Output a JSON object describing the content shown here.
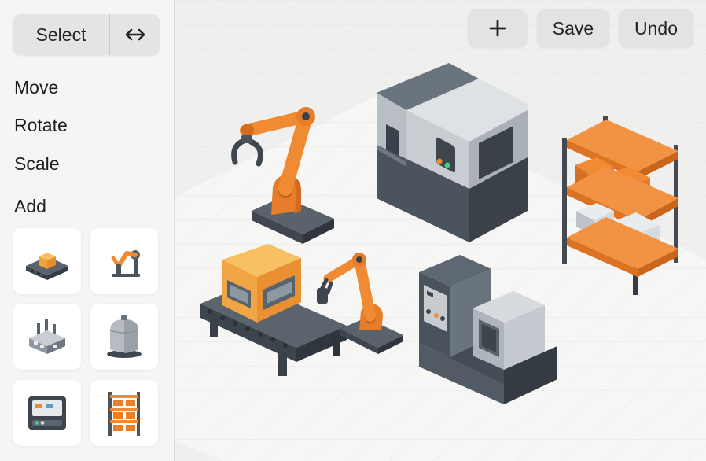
{
  "sidebar": {
    "mode": {
      "select_label": "Select",
      "swap_icon": "horizontal-arrows-icon"
    },
    "tools": {
      "move_label": "Move",
      "rotate_label": "Rotate",
      "scale_label": "Scale"
    },
    "add_label": "Add",
    "palette": [
      {
        "name": "conveyor-with-box",
        "icon": "conveyor-icon"
      },
      {
        "name": "robot-arm",
        "icon": "robot-arm-icon"
      },
      {
        "name": "factory-building",
        "icon": "factory-icon"
      },
      {
        "name": "storage-tank",
        "icon": "tank-icon"
      },
      {
        "name": "control-panel",
        "icon": "control-panel-icon"
      },
      {
        "name": "shelving-rack",
        "icon": "shelf-icon"
      }
    ]
  },
  "toolbar": {
    "add_icon": "plus-icon",
    "save_label": "Save",
    "undo_label": "Undo"
  },
  "scene": {
    "objects": [
      "robot-arm-large",
      "cnc-machine",
      "storage-shelf",
      "conveyor-machine",
      "robot-arm-small",
      "control-machine"
    ]
  },
  "colors": {
    "accent_orange": "#f08a33",
    "machine_gray": "#5a6470",
    "panel_gray": "#c9cdd2",
    "box_yellow": "#f7b34a"
  }
}
